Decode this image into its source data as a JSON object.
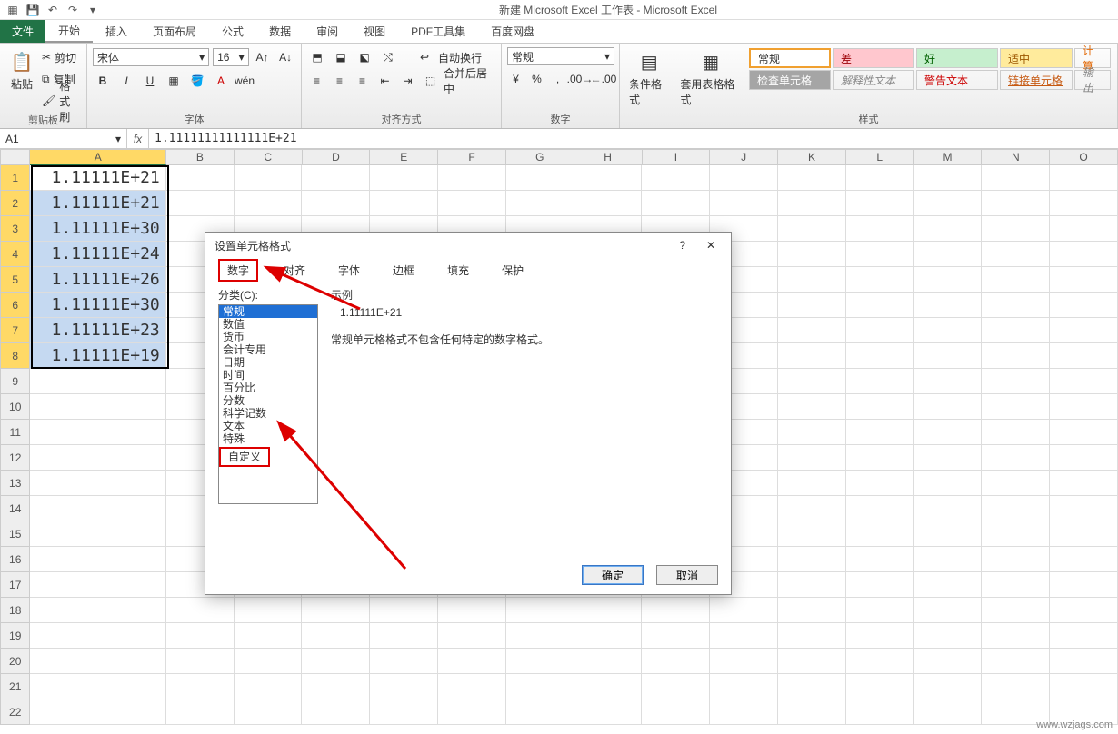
{
  "window": {
    "title": "新建 Microsoft Excel 工作表 - Microsoft Excel"
  },
  "tabs": {
    "file": "文件",
    "items": [
      "开始",
      "插入",
      "页面布局",
      "公式",
      "数据",
      "审阅",
      "视图",
      "PDF工具集",
      "百度网盘"
    ]
  },
  "ribbon": {
    "clipboard": {
      "label": "剪贴板",
      "paste": "粘贴",
      "cut": "剪切",
      "copy": "复制",
      "painter": "格式刷"
    },
    "font": {
      "label": "字体",
      "name": "宋体",
      "size": "16"
    },
    "align": {
      "label": "对齐方式",
      "wrap": "自动换行",
      "merge": "合并后居中"
    },
    "number": {
      "label": "数字",
      "format": "常规"
    },
    "styles": {
      "label": "样式",
      "condfmt": "条件格式",
      "tablefmt": "套用表格格式",
      "cells": {
        "normal": "常规",
        "bad": "差",
        "good": "好",
        "neutral": "适中",
        "check": "检查单元格",
        "explain": "解释性文本",
        "warn": "警告文本",
        "link": "链接单元格",
        "calc": "计算",
        "output": "输出"
      }
    }
  },
  "fbar": {
    "name": "A1",
    "formula": "1.11111111111111E+21"
  },
  "columns": [
    "A",
    "B",
    "C",
    "D",
    "E",
    "F",
    "G",
    "H",
    "I",
    "J",
    "K",
    "L",
    "M",
    "N",
    "O"
  ],
  "data": {
    "A": [
      "1.11111E+21",
      "1.11111E+21",
      "1.11111E+30",
      "1.11111E+24",
      "1.11111E+26",
      "1.11111E+30",
      "1.11111E+23",
      "1.11111E+19"
    ]
  },
  "dialog": {
    "title": "设置单元格格式",
    "tabs": [
      "数字",
      "对齐",
      "字体",
      "边框",
      "填充",
      "保护"
    ],
    "category_label": "分类(C):",
    "categories": [
      "常规",
      "数值",
      "货币",
      "会计专用",
      "日期",
      "时间",
      "百分比",
      "分数",
      "科学记数",
      "文本",
      "特殊",
      "自定义"
    ],
    "selected_category": "常规",
    "highlight_category": "自定义",
    "sample_label": "示例",
    "sample_value": "1.11111E+21",
    "description": "常规单元格格式不包含任何特定的数字格式。",
    "ok": "确定",
    "cancel": "取消"
  },
  "watermark": "www.wzjags.com"
}
